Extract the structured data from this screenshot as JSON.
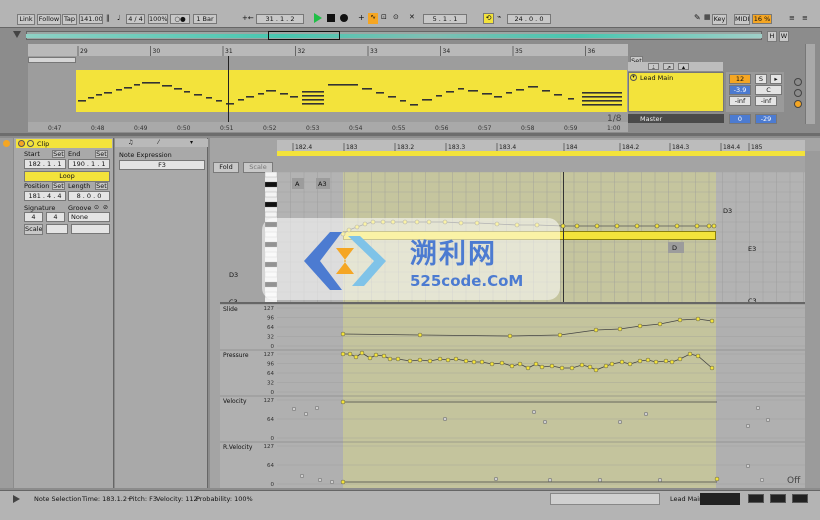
{
  "transport": {
    "link": "Link",
    "follow": "Follow",
    "tap": "Tap",
    "tempo": "141.00",
    "signature": "4 / 4",
    "loop_ind": "○●",
    "quant": "1 Bar",
    "position": "31 .  1 .  2",
    "loop_start": "5 .  1 .  1",
    "loop_len": "24 .  0 .  0",
    "zoom": "100%",
    "key": "Key",
    "midi": "MIDI",
    "cpu": "16 %"
  },
  "arrangement": {
    "bar_labels": [
      "29",
      "30",
      "31",
      "32",
      "33",
      "34",
      "35",
      "36"
    ],
    "time_labels": [
      "0:47",
      "0:48",
      "0:49",
      "0:50",
      "0:51",
      "0:52",
      "0:53",
      "0:54",
      "0:55",
      "0:56",
      "0:57",
      "0:58",
      "0:59",
      "1:00"
    ],
    "set_label": "Set",
    "fraction": "1/8",
    "tracks": [
      {
        "name": "Lead Main",
        "vol": "12",
        "s": "S",
        "pan": "-3.9",
        "c": "C",
        "send_a": "-inf",
        "send_b": "-inf"
      },
      {
        "name": "Master",
        "vol": "0",
        "vol2": "-29"
      }
    ]
  },
  "clip": {
    "title": "Clip",
    "start_label": "Start",
    "end_label": "End",
    "set": "Set",
    "start": "182 .  1 .  1",
    "end": "190 .  1 .  1",
    "loop": "Loop",
    "position_label": "Position",
    "length_label": "Length",
    "position": "181 .  4 .  4",
    "length": "8 .  0 .  0",
    "signature_label": "Signature",
    "groove_label": "Groove",
    "sig_num": "4",
    "sig_den": "4",
    "groove": "None",
    "scale": "Scale"
  },
  "note_expression": {
    "title": "Note Expression",
    "pitch": "F3"
  },
  "editor": {
    "fold": "Fold",
    "scale": "Scale",
    "bar_labels": [
      "182.4",
      "183",
      "183.2",
      "183.3",
      "183.4",
      "184",
      "184.2",
      "184.3",
      "184.4",
      "185"
    ],
    "note_labels": [
      "A",
      "A3",
      "D3",
      "D3",
      "E3",
      "D",
      "C3",
      "C3"
    ],
    "lanes": [
      {
        "name": "Slide",
        "ticks": [
          "127",
          "96",
          "64",
          "32",
          "0"
        ]
      },
      {
        "name": "Pressure",
        "ticks": [
          "127",
          "96",
          "64",
          "32",
          "0"
        ]
      },
      {
        "name": "Velocity",
        "ticks": [
          "127",
          "64",
          "0"
        ]
      },
      {
        "name": "R.Velocity",
        "ticks": [
          "127",
          "64",
          "0"
        ]
      }
    ],
    "off": "Off"
  },
  "status": {
    "note_selection": "Note Selection",
    "time": "Time: 183.1.2+",
    "pitch": "Pitch: F3",
    "velocity": "Velocity: 112",
    "probability": "Probability: 100%",
    "track": "Lead Main"
  },
  "watermark": {
    "title": "溯利网",
    "url": "525code.CoM"
  },
  "colors": {
    "yellow": "#f3e33b",
    "accent": "#f5a623",
    "blue": "#4c7bd1",
    "teal": "#46c7b0"
  }
}
